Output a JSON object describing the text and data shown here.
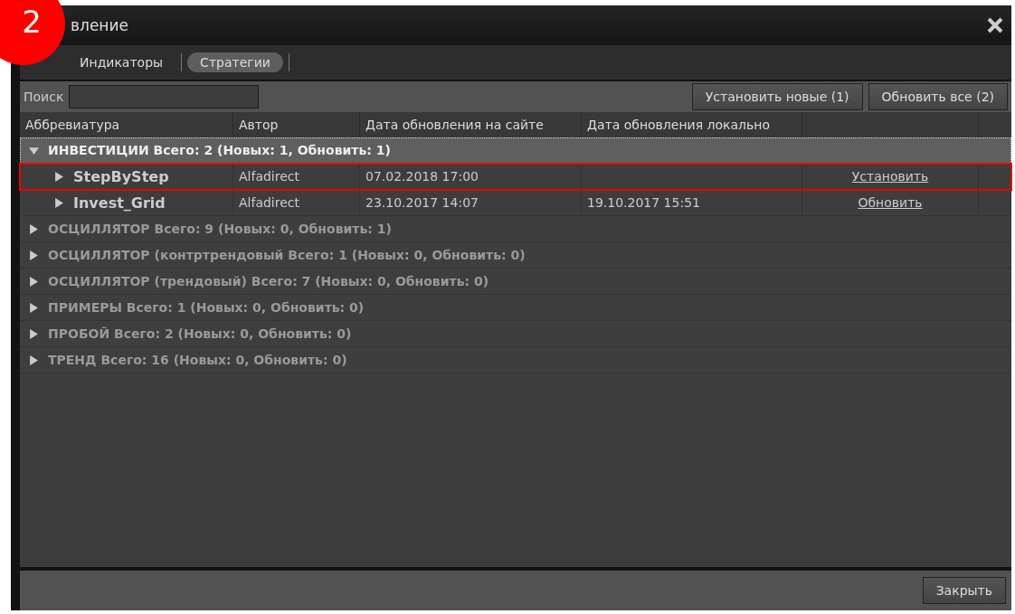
{
  "badge": "2",
  "window": {
    "title": "вление"
  },
  "tabs": [
    {
      "label": "Индикаторы",
      "selected": false
    },
    {
      "label": "Стратегии",
      "selected": true
    }
  ],
  "search": {
    "label": "Поиск"
  },
  "toolbar_buttons": [
    "Установить новые (1)",
    "Обновить все (2)"
  ],
  "table": {
    "columns": [
      "Аббревиатура",
      "Автор",
      "Дата обновления на сайте",
      "Дата обновления локально"
    ],
    "groups": [
      {
        "label": "ИНВЕСТИЦИИ Всего: 2 (Новых: 1, Обновить: 1)",
        "expanded": true,
        "children": [
          {
            "name": "StepByStep",
            "author": "Alfadirect",
            "site_date": "07.02.2018 17:00",
            "action": "Установить",
            "highlighted": true
          },
          {
            "name": "Invest_Grid",
            "author": "Alfadirect",
            "site_date": "23.10.2017 14:07",
            "local_date": "19.10.2017 15:51",
            "action": "Обновить",
            "highlighted": false
          }
        ]
      },
      {
        "label": "ОСЦИЛЛЯТОР Всего: 9 (Новых: 0, Обновить: 1)",
        "expanded": false
      },
      {
        "label": "ОСЦИЛЛЯТОР (контртрендовый Всего: 1 (Новых: 0, Обновить: 0)",
        "expanded": false
      },
      {
        "label": "ОСЦИЛЛЯТОР (трендовый) Всего: 7 (Новых: 0, Обновить: 0)",
        "expanded": false
      },
      {
        "label": "ПРИМЕРЫ Всего: 1 (Новых: 0, Обновить: 0)",
        "expanded": false
      },
      {
        "label": "ПРОБОЙ Всего: 2 (Новых: 0, Обновить: 0)",
        "expanded": false
      },
      {
        "label": "ТРЕНД Всего: 16 (Новых: 0, Обновить: 0)",
        "expanded": false
      }
    ]
  },
  "footer_button": "Закрыть"
}
